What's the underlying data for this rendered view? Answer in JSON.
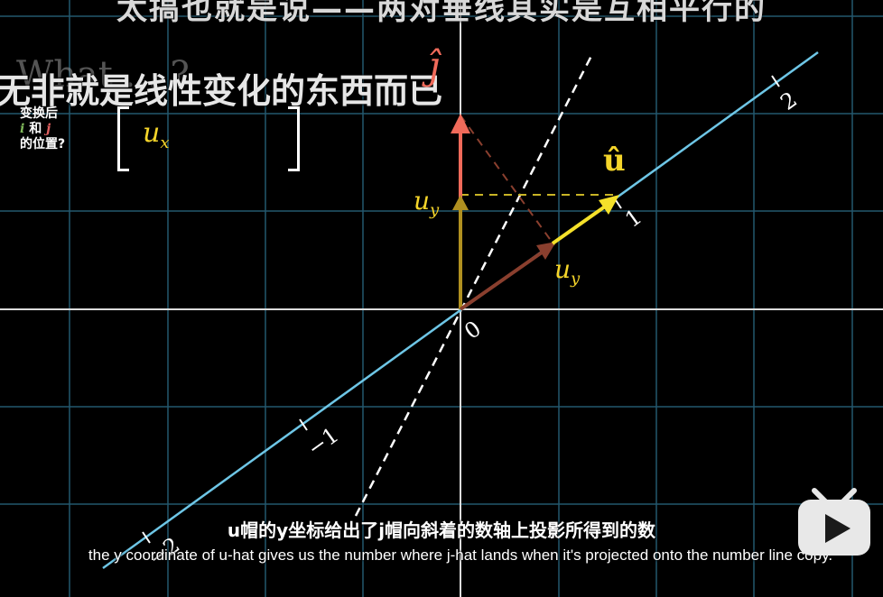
{
  "subtitles": {
    "top_cn": "太搞也就是说——两对垂线其实是互相平行的",
    "overlay_cn": "无非就是线性变化的东西而已",
    "ghost_text": "What ... ?",
    "bottom_cn": "u帽的y坐标给出了j帽向斜着的数轴上投影所得到的数",
    "bottom_en": "the y coordinate of u-hat gives us the number where j-hat lands when it's projected onto the number line copy."
  },
  "question": {
    "line1": "变换后",
    "i": "i",
    "and": " 和 ",
    "j": "j",
    "line3": "的位置?"
  },
  "matrix": {
    "entry": "u",
    "sub": "x"
  },
  "labels": {
    "u_hat": "û",
    "j_hat": "ĵ",
    "u_y_left": "u",
    "u_y_left_sub": "y",
    "u_y_right": "u",
    "u_y_right_sub": "y",
    "num_2": "2",
    "num_1": "1",
    "num_0": "0",
    "num_neg1": "−1",
    "num_neg2": "−2"
  },
  "colors": {
    "background": "#000000",
    "grid": "#2d6f8a",
    "number_line": "#6ec6e6",
    "u_vector": "#f5e12a",
    "j_vector": "#f06a5a",
    "projection": "#8a3f2e",
    "uy_component": "#b09020",
    "dashed_white": "#ffffff",
    "dashed_yellow": "#c9b425",
    "logo": "#e8e8e8"
  },
  "icons": {
    "logo": "bilibili-tv-play-icon"
  }
}
